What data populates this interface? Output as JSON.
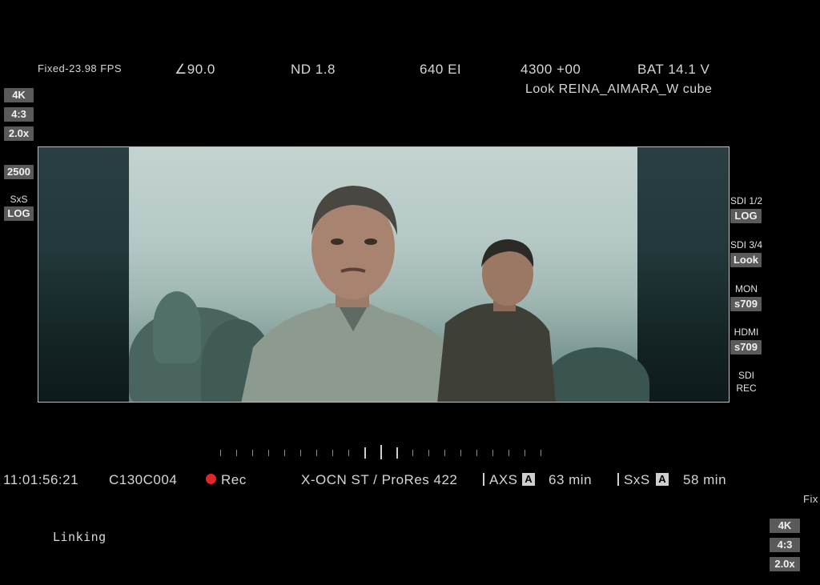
{
  "top_bar": {
    "fps": "Fixed-23.98 FPS",
    "shutter": "∠90.0",
    "nd": "ND 1.8",
    "ei": "640 EI",
    "white_balance": "4300 +00",
    "battery": "BAT 14.1 V",
    "look": "Look REINA_AIMARA_W cube"
  },
  "left_panel": {
    "resolution": "4K",
    "aspect": "4:3",
    "squeeze": "2.0x",
    "iso_badge": "2500",
    "media_label": "SxS",
    "gamma_badge": "LOG"
  },
  "right_panel": {
    "outputs": [
      {
        "label": "SDI 1/2",
        "value": "LOG"
      },
      {
        "label": "SDI 3/4",
        "value": "Look"
      },
      {
        "label": "MON",
        "value": "s709"
      },
      {
        "label": "HDMI",
        "value": "s709"
      }
    ],
    "sdi_rec_line1": "SDI",
    "sdi_rec_line2": "REC"
  },
  "bottom_bar": {
    "timecode": "11:01:56:21",
    "clip_name": "C130C004",
    "rec_label": "Rec",
    "codec": "X-OCN ST / ProRes 422",
    "axs_label": "AXS",
    "axs_remaining": "63 min",
    "sxs_label": "SxS",
    "sxs_remaining": "58 min",
    "card_icon_letter": "A"
  },
  "status": {
    "linking": "Linking"
  },
  "corner_panel": {
    "partial_text": "Fix",
    "resolution": "4K",
    "aspect": "4:3",
    "squeeze": "2.0x"
  },
  "colors": {
    "rec_dot": "#e0262b",
    "badge_bg": "#5a5a5a",
    "frame_border": "#bdbdbd"
  }
}
